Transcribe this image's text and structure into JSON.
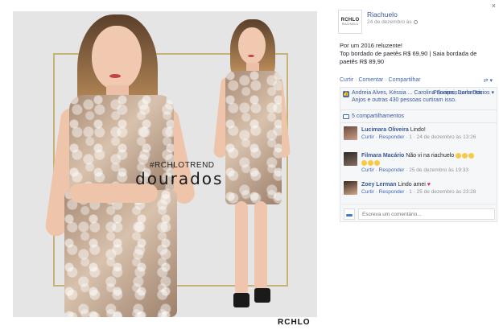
{
  "photo": {
    "hashtag": "#RCHLOTREND",
    "headline": "dourados",
    "brand": "RCHLO"
  },
  "panel": {
    "close_icon": "×",
    "page_logo": "RCHLO",
    "page_logo_sub": "RIACHUELO",
    "page_name": "Riachuelo",
    "post_date": "24 de dezembro às",
    "post_text": [
      "Por um 2016 reluzente!",
      "Top bordado de paetês R$ 69,90 | Saia bordada de",
      "paetês R$ 89,90"
    ],
    "actions": {
      "like": "Curtir",
      "comment": "Comentar",
      "share": "Compartilhar"
    },
    "likes_text": "Andreia Alves, Késsia ... Carolina Soares, Darla Dos Anjos e outras 430 pessoas curtiram isso.",
    "sort_label": "Principais comentários",
    "shares_text": "5 compartilhamentos",
    "comments": [
      {
        "name": "Lucimara Oliveira",
        "text": "Lindo!",
        "reply": "Curtir · Responder",
        "meta": "1 · 24 de dezembro às 13:26"
      },
      {
        "name": "Filmara Macário",
        "text": "Não vi na riachuelo",
        "reply": "Curtir · Responder",
        "meta": "25 de dezembro às 19:33"
      },
      {
        "name": "Zoey Lerman",
        "text": "Lindo amei",
        "reply": "Curtir · Responder",
        "meta": "1 · 25 de dezembro às 23:28"
      }
    ],
    "write_placeholder": "Escreva um comentário..."
  }
}
